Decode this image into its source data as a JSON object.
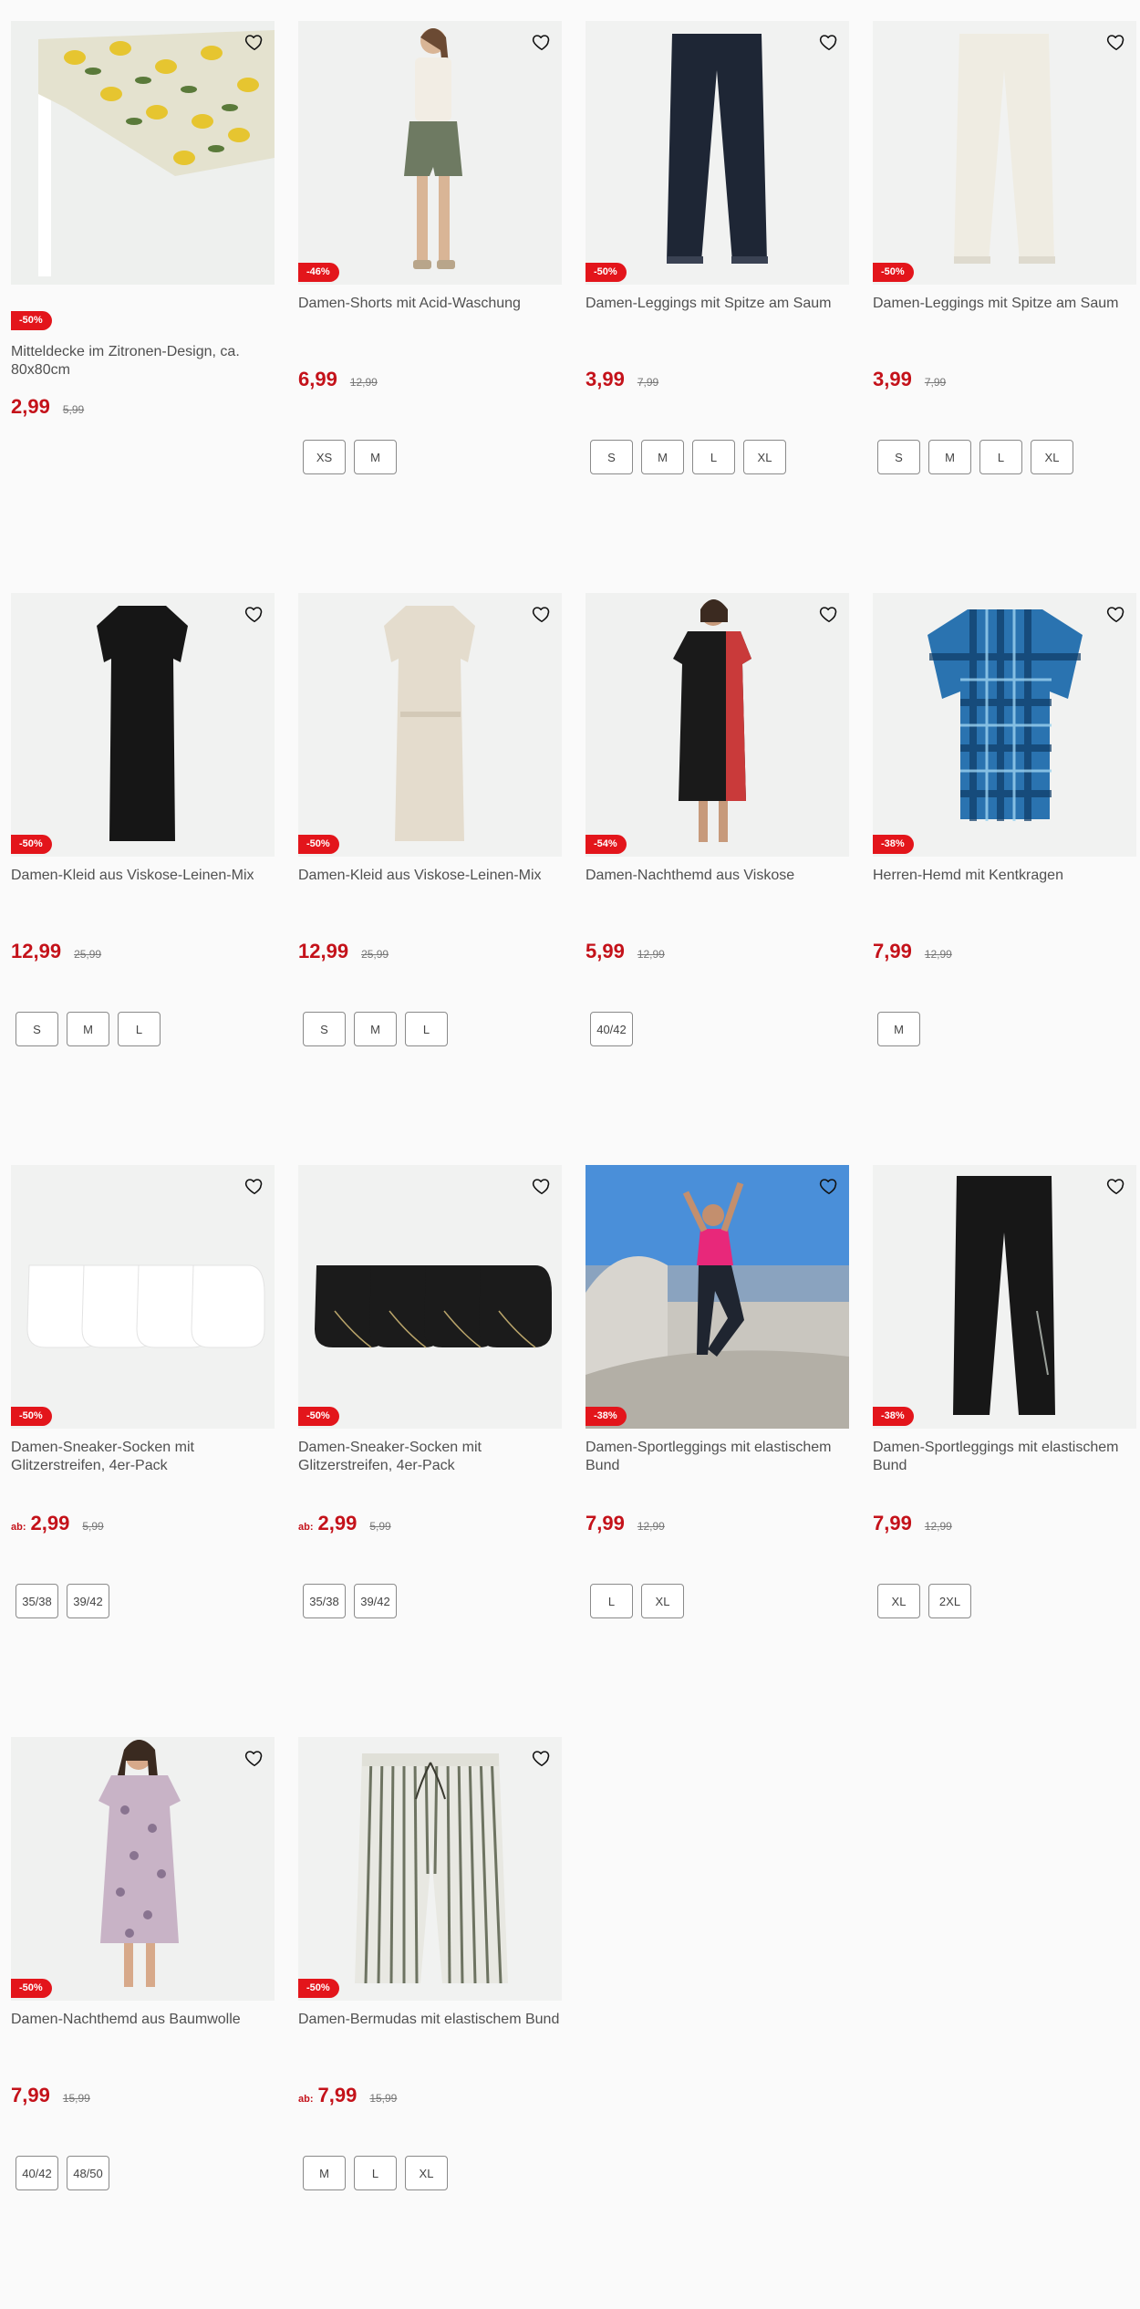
{
  "products": [
    {
      "title": "Mitteldecke im Zitronen-Design, ca. 80x80cm",
      "badge": "-50%",
      "price_prefix": "",
      "price": "2,99",
      "old_price": "5,99",
      "sizes": [],
      "image": "tablecloth-lemon-image"
    },
    {
      "title": "Damen-Shorts mit Acid-Waschung",
      "badge": "-46%",
      "price_prefix": "",
      "price": "6,99",
      "old_price": "12,99",
      "sizes": [
        "XS",
        "M"
      ],
      "image": "woman-shorts-image"
    },
    {
      "title": "Damen-Leggings mit Spitze am Saum",
      "badge": "-50%",
      "price_prefix": "",
      "price": "3,99",
      "old_price": "7,99",
      "sizes": [
        "S",
        "M",
        "L",
        "XL"
      ],
      "image": "leggings-navy-image"
    },
    {
      "title": "Damen-Leggings mit Spitze am Saum",
      "badge": "-50%",
      "price_prefix": "",
      "price": "3,99",
      "old_price": "7,99",
      "sizes": [
        "S",
        "M",
        "L",
        "XL"
      ],
      "image": "leggings-cream-image"
    },
    {
      "title": "Damen-Kleid aus Viskose-Leinen-Mix",
      "badge": "-50%",
      "price_prefix": "",
      "price": "12,99",
      "old_price": "25,99",
      "sizes": [
        "S",
        "M",
        "L"
      ],
      "image": "dress-black-image"
    },
    {
      "title": "Damen-Kleid aus Viskose-Leinen-Mix",
      "badge": "-50%",
      "price_prefix": "",
      "price": "12,99",
      "old_price": "25,99",
      "sizes": [
        "S",
        "M",
        "L"
      ],
      "image": "dress-beige-image"
    },
    {
      "title": "Damen-Nachthemd aus Viskose",
      "badge": "-54%",
      "price_prefix": "",
      "price": "5,99",
      "old_price": "12,99",
      "sizes": [
        "40/42"
      ],
      "image": "nightdress-black-image"
    },
    {
      "title": "Herren-Hemd mit Kentkragen",
      "badge": "-38%",
      "price_prefix": "",
      "price": "7,99",
      "old_price": "12,99",
      "sizes": [
        "M"
      ],
      "image": "shirt-plaid-image"
    },
    {
      "title": "Damen-Sneaker-Socken mit Glitzerstreifen, 4er-Pack",
      "badge": "-50%",
      "price_prefix": "ab:",
      "price": "2,99",
      "old_price": "5,99",
      "sizes": [
        "35/38",
        "39/42"
      ],
      "image": "socks-white-image"
    },
    {
      "title": "Damen-Sneaker-Socken mit Glitzerstreifen, 4er-Pack",
      "badge": "-50%",
      "price_prefix": "ab:",
      "price": "2,99",
      "old_price": "5,99",
      "sizes": [
        "35/38",
        "39/42"
      ],
      "image": "socks-black-image"
    },
    {
      "title": "Damen-Sportleggings mit elastischem Bund",
      "badge": "-38%",
      "price_prefix": "",
      "price": "7,99",
      "old_price": "12,99",
      "sizes": [
        "L",
        "XL"
      ],
      "image": "woman-jumping-image"
    },
    {
      "title": "Damen-Sportleggings mit elastischem Bund",
      "badge": "-38%",
      "price_prefix": "",
      "price": "7,99",
      "old_price": "12,99",
      "sizes": [
        "XL",
        "2XL"
      ],
      "image": "sport-leggings-image"
    },
    {
      "title": "Damen-Nachthemd aus Baumwolle",
      "badge": "-50%",
      "price_prefix": "",
      "price": "7,99",
      "old_price": "15,99",
      "sizes": [
        "40/42",
        "48/50"
      ],
      "image": "nightdress-floral-image"
    },
    {
      "title": "Damen-Bermudas mit elastischem Bund",
      "badge": "-50%",
      "price_prefix": "ab:",
      "price": "7,99",
      "old_price": "15,99",
      "sizes": [
        "M",
        "L",
        "XL"
      ],
      "image": "bermudas-striped-image"
    }
  ],
  "colors": {
    "sale_red": "#e3151b",
    "price_red": "#c4121a",
    "text": "#505050",
    "image_bg": "#f1f2f1"
  },
  "icons": {
    "wishlist": "heart-outline-icon"
  }
}
